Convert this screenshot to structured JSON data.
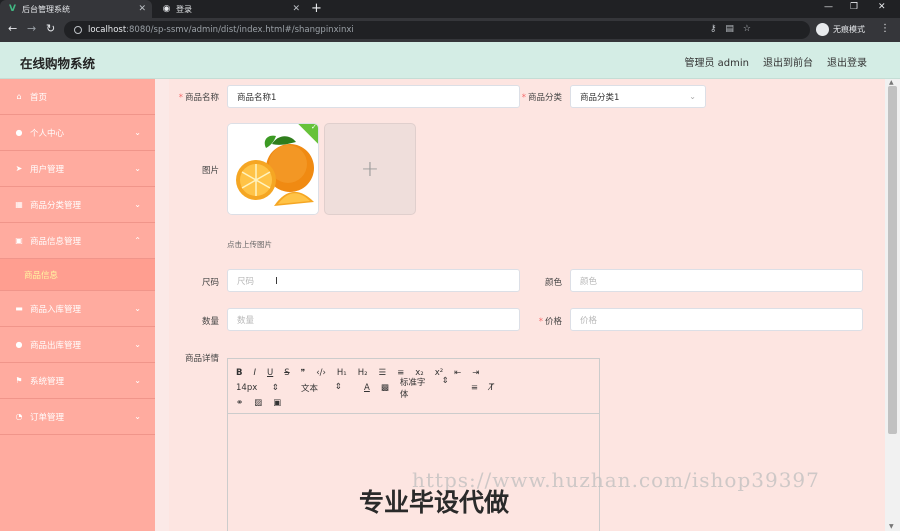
{
  "browser": {
    "tabs": [
      {
        "label": "后台管理系统",
        "active": true
      },
      {
        "label": "登录",
        "active": false
      }
    ],
    "url_host": "localhost",
    "url_rest": ":8080/sp-ssmv/admin/dist/index.html#/shangpinxinxi",
    "incognito_label": "无痕模式"
  },
  "header": {
    "title": "在线购物系统",
    "user": "管理员 admin",
    "back_to_front": "退出到前台",
    "logout": "退出登录"
  },
  "sidebar": {
    "items": [
      {
        "label": "首页",
        "icon": "home-icon"
      },
      {
        "label": "个人中心",
        "icon": "user-icon"
      },
      {
        "label": "用户管理",
        "icon": "send-icon"
      },
      {
        "label": "商品分类管理",
        "icon": "grid-icon"
      },
      {
        "label": "商品信息管理",
        "icon": "clipboard-icon"
      },
      {
        "label": "商品入库管理",
        "icon": "ticket-icon"
      },
      {
        "label": "商品出库管理",
        "icon": "user-icon"
      },
      {
        "label": "系统管理",
        "icon": "flag-icon"
      },
      {
        "label": "订单管理",
        "icon": "dashboard-icon"
      }
    ],
    "sub_active": "商品信息"
  },
  "form": {
    "name_label": "商品名称",
    "name_value": "商品名称1",
    "category_label": "商品分类",
    "category_value": "商品分类1",
    "image_label": "图片",
    "upload_tip": "点击上传图片",
    "size_label": "尺码",
    "size_placeholder": "尺码",
    "color_label": "颜色",
    "color_placeholder": "颜色",
    "qty_label": "数量",
    "qty_placeholder": "数量",
    "price_label": "价格",
    "price_placeholder": "价格",
    "detail_label": "商品详情"
  },
  "editor": {
    "font_size": "14px",
    "text_type": "文本",
    "font_family": "标准字体"
  },
  "watermark": {
    "url": "https://www.huzhan.com/ishop39397",
    "text": "专业毕设代做"
  }
}
